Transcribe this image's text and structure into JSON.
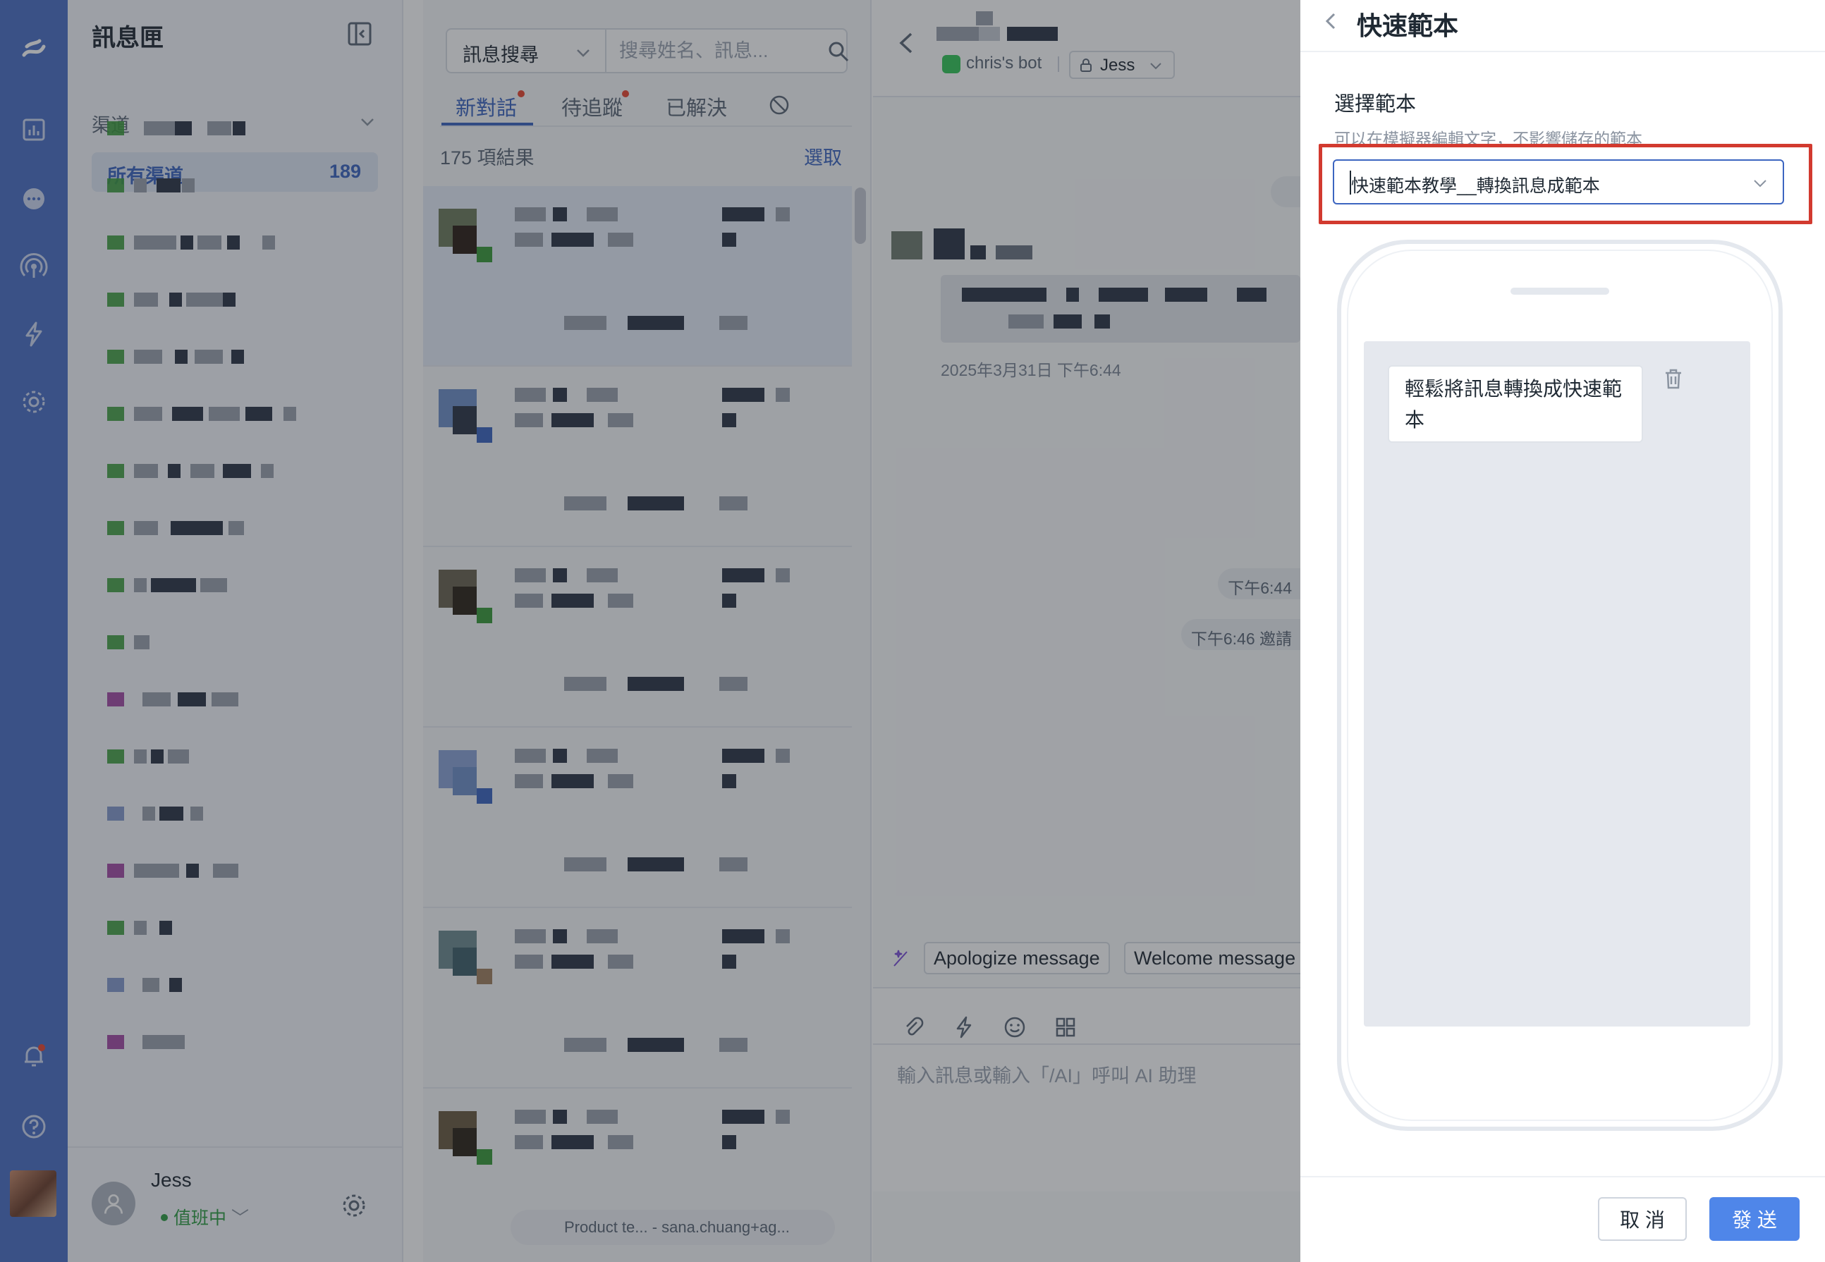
{
  "sidebar": {
    "title": "訊息匣",
    "channels_label": "渠道",
    "all_channels": {
      "label": "所有渠道",
      "count": "189"
    },
    "user": {
      "name": "Jess",
      "status": "值班中"
    }
  },
  "list": {
    "search_type": "訊息搜尋",
    "search_placeholder": "搜尋姓名、訊息...",
    "tabs": [
      {
        "label": "新對話",
        "has_dot": true,
        "active": true
      },
      {
        "label": "待追蹤",
        "has_dot": true,
        "active": false
      },
      {
        "label": "已解決",
        "has_dot": false,
        "active": false
      }
    ],
    "result_count": "175 項結果",
    "select_label": "選取",
    "bottom_chip": "Product te...  -  sana.chuang+ag..."
  },
  "chat": {
    "bot_name": "chris's bot",
    "assignee": "Jess",
    "message_date": "2025年3月31日 下午6:44",
    "system_pills": [
      "下午6:44",
      "下午6:46 邀請"
    ],
    "suggestions": [
      "Apologize message",
      "Welcome message"
    ],
    "composer_placeholder": "輸入訊息或輸入「/AI」呼叫 AI 助理"
  },
  "panel": {
    "title": "快速範本",
    "choose_label": "選擇範本",
    "choose_hint": "可以在模擬器編輯文字，不影響儲存的範本",
    "selected_template": "快速範本教學__轉換訊息成範本",
    "preview_message": "輕鬆將訊息轉換成快速範本",
    "cancel_label": "取 消",
    "send_label": "發 送"
  },
  "colors": {
    "rail": "#4a6fc4",
    "accent": "#3c65c0",
    "primary_button": "#4f86e9",
    "highlight_box": "#d23a2f",
    "online": "#2f9e44"
  }
}
